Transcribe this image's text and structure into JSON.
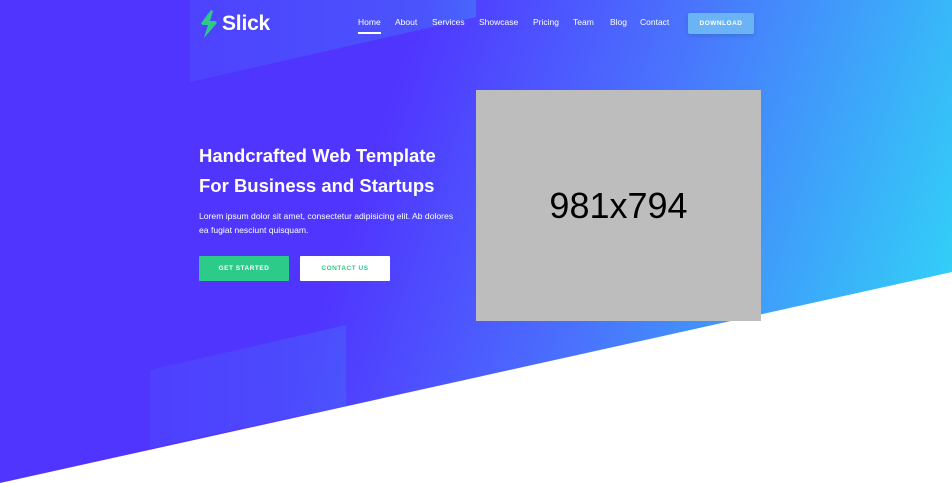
{
  "brand": {
    "name": "Slick",
    "logo_icon": "lightning-s-icon",
    "logo_color": "#2dcb89"
  },
  "nav": {
    "items": [
      {
        "label": "Home",
        "active": true
      },
      {
        "label": "About",
        "active": false
      },
      {
        "label": "Services",
        "active": false
      },
      {
        "label": "Showcase",
        "active": false
      },
      {
        "label": "Pricing",
        "active": false
      },
      {
        "label": "Team",
        "active": false
      },
      {
        "label": "Blog",
        "active": false
      },
      {
        "label": "Contact",
        "active": false
      }
    ],
    "download_label": "DOWNLOAD"
  },
  "hero": {
    "title_line1": "Handcrafted Web Template",
    "title_line2": "For Business and Startups",
    "text": "Lorem ipsum dolor sit amet, consectetur adipisicing elit. Ab dolores ea fugiat nesciunt quisquam.",
    "primary_button": "GET STARTED",
    "secondary_button": "CONTACT US",
    "image_placeholder": "981x794"
  },
  "colors": {
    "gradient_start": "#5035ff",
    "gradient_end": "#2ee0f6",
    "accent_green": "#2dcb89",
    "download_button": "#6ab4f5",
    "placeholder_bg": "#bdbdbd"
  }
}
